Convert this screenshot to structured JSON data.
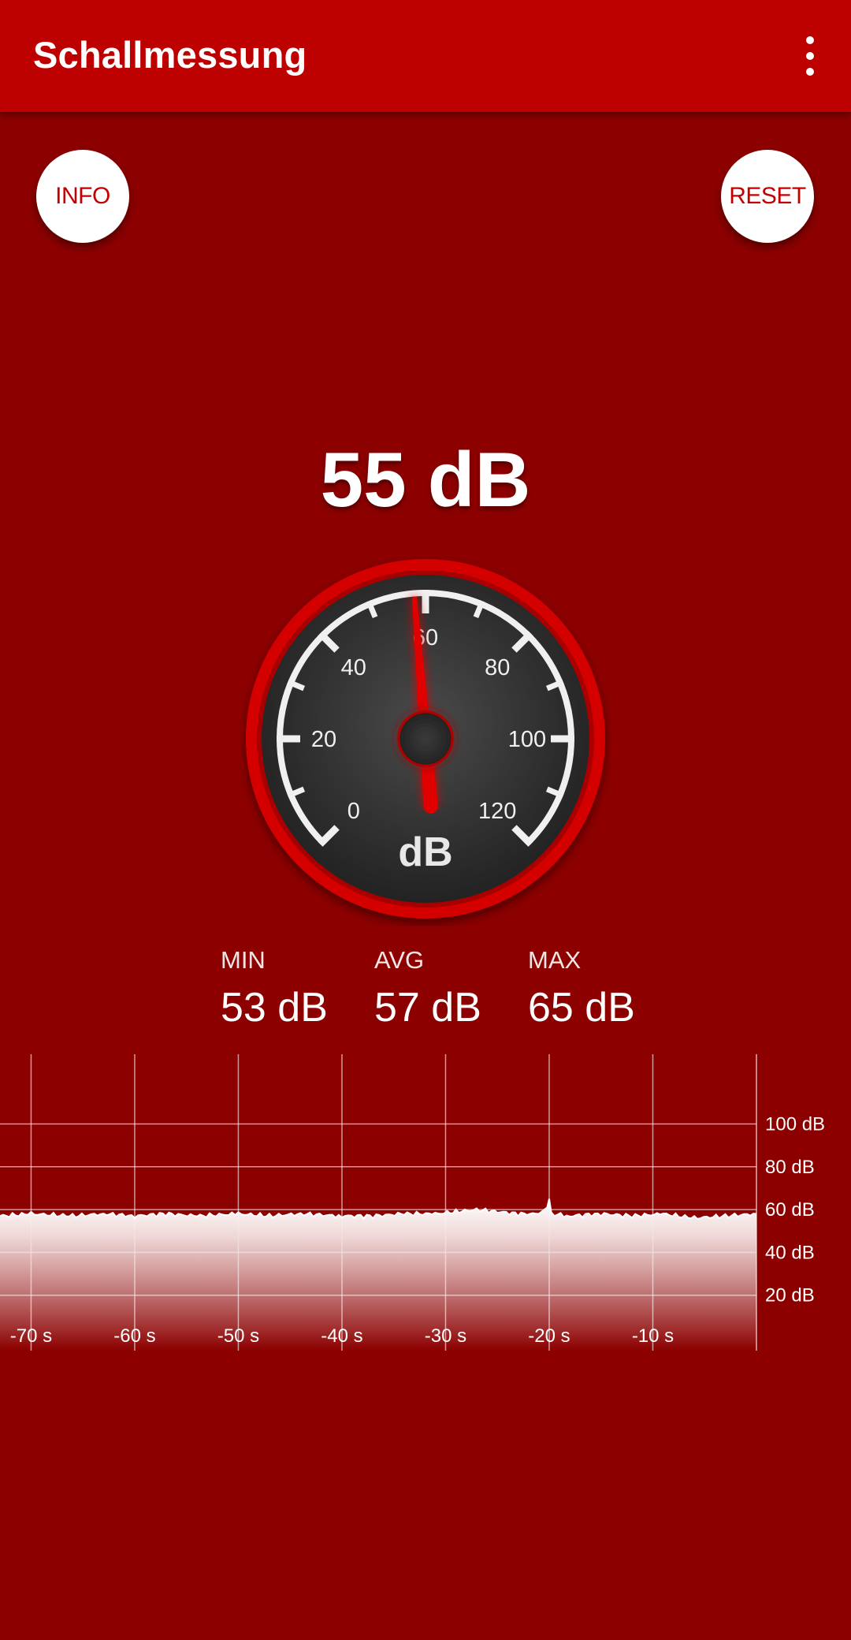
{
  "app": {
    "title": "Schallmessung",
    "menu_icon": "more-vert-icon"
  },
  "buttons": {
    "info": "INFO",
    "reset": "RESET"
  },
  "reading": {
    "text": "55 dB",
    "value": 55
  },
  "gauge": {
    "unit": "dB",
    "ticks": [
      "0",
      "20",
      "40",
      "60",
      "80",
      "100",
      "120"
    ],
    "min": 0,
    "max": 120,
    "needle_value": 58
  },
  "stats": {
    "min": {
      "label": "MIN",
      "value": "53 dB"
    },
    "avg": {
      "label": "AVG",
      "value": "57 dB"
    },
    "max": {
      "label": "MAX",
      "value": "65 dB"
    }
  },
  "colors": {
    "background": "#8c0000",
    "appbar": "#bd0000",
    "accent": "#e00000"
  },
  "chart_data": {
    "type": "area",
    "x_unit": "s",
    "x_range": [
      -73,
      0
    ],
    "y_range": [
      0,
      116
    ],
    "x_ticks": [
      "-70 s",
      "-60 s",
      "-50 s",
      "-40 s",
      "-30 s",
      "-20 s",
      "-10 s"
    ],
    "y_ticks": [
      "100 dB",
      "80 dB",
      "60 dB",
      "40 dB",
      "20 dB"
    ],
    "x": [
      -73,
      -70,
      -66,
      -63,
      -60,
      -57,
      -54,
      -50,
      -47,
      -44,
      -40,
      -37,
      -34,
      -31,
      -29,
      -27,
      -25,
      -23,
      -21,
      -20.2,
      -20,
      -19.8,
      -18,
      -15,
      -12,
      -9,
      -6,
      -3,
      0
    ],
    "y": [
      57,
      58,
      57,
      58,
      57,
      58,
      57,
      58,
      57,
      58,
      57,
      57,
      58,
      58,
      59,
      60,
      59,
      58,
      58,
      61,
      65,
      58,
      57,
      58,
      57,
      58,
      56,
      57,
      58
    ]
  }
}
